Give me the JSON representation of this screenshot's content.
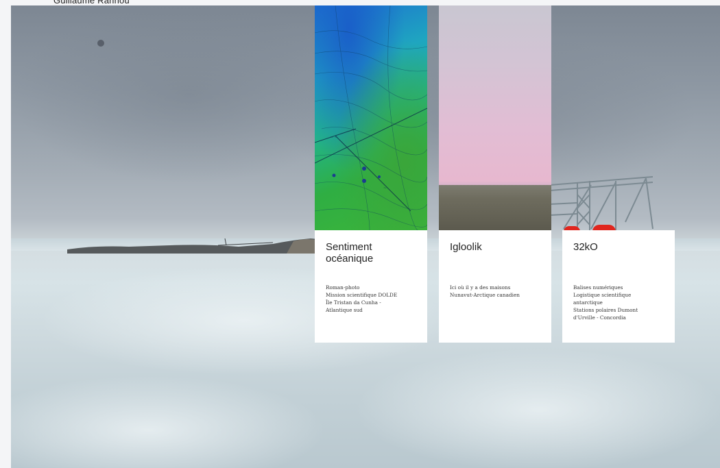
{
  "site": {
    "author_name": "Guillaume Rannou"
  },
  "projects": [
    {
      "title_lines": [
        "Sentiment",
        "océanique"
      ],
      "description_lines": [
        "Roman-photo",
        "Mission scientifique DOLDE",
        "Île Tristan da Cunha -",
        "Atlantique sud"
      ],
      "thumbnail": "bathymetric-map"
    },
    {
      "title_lines": [
        "Igloolik"
      ],
      "description_lines": [
        "Ici où il y a des maisons",
        "Nunavut-Arctique canadien"
      ],
      "thumbnail": "pink-sky-tundra"
    },
    {
      "title_lines": [
        "32kO"
      ],
      "description_lines": [
        "Balises numériques",
        "Logistique scientifique",
        "antarctique",
        "Stations polaires Dumont",
        "d'Urville - Concordia"
      ],
      "thumbnail": "antarctic-crane"
    }
  ],
  "colors": {
    "card_background": "#ffffff",
    "text": "#222222"
  }
}
